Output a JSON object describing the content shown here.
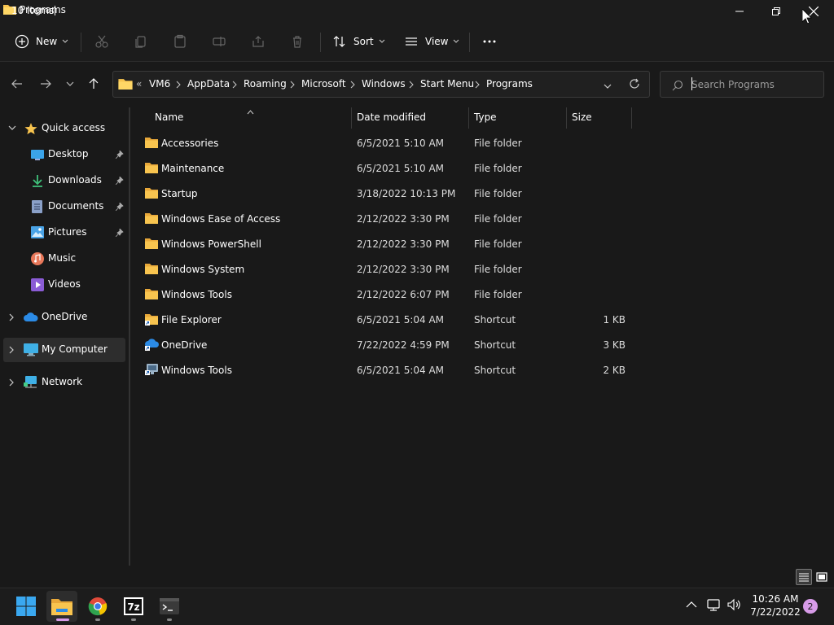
{
  "window": {
    "title": "Programs"
  },
  "toolbar": {
    "new_label": "New",
    "sort_label": "Sort",
    "view_label": "View"
  },
  "address": {
    "overflow": "«",
    "crumbs": [
      "VM6",
      "AppData",
      "Roaming",
      "Microsoft",
      "Windows",
      "Start Menu",
      "Programs"
    ]
  },
  "search": {
    "placeholder": "Search Programs"
  },
  "sidebar": {
    "quick_access": "Quick access",
    "items": [
      {
        "label": "Desktop",
        "icon": "desktop-icon",
        "pinned": true
      },
      {
        "label": "Downloads",
        "icon": "downloads-icon",
        "pinned": true
      },
      {
        "label": "Documents",
        "icon": "documents-icon",
        "pinned": true
      },
      {
        "label": "Pictures",
        "icon": "pictures-icon",
        "pinned": true
      },
      {
        "label": "Music",
        "icon": "music-icon",
        "pinned": false
      },
      {
        "label": "Videos",
        "icon": "videos-icon",
        "pinned": false
      }
    ],
    "onedrive": "OneDrive",
    "my_computer": "My Computer",
    "network": "Network"
  },
  "columns": {
    "name": "Name",
    "date": "Date modified",
    "type": "Type",
    "size": "Size"
  },
  "files": [
    {
      "name": "Accessories",
      "date": "6/5/2021 5:10 AM",
      "type": "File folder",
      "size": "",
      "icon": "folder-icon"
    },
    {
      "name": "Maintenance",
      "date": "6/5/2021 5:10 AM",
      "type": "File folder",
      "size": "",
      "icon": "folder-icon"
    },
    {
      "name": "Startup",
      "date": "3/18/2022 10:13 PM",
      "type": "File folder",
      "size": "",
      "icon": "folder-icon"
    },
    {
      "name": "Windows Ease of Access",
      "date": "2/12/2022 3:30 PM",
      "type": "File folder",
      "size": "",
      "icon": "folder-icon"
    },
    {
      "name": "Windows PowerShell",
      "date": "2/12/2022 3:30 PM",
      "type": "File folder",
      "size": "",
      "icon": "folder-icon"
    },
    {
      "name": "Windows System",
      "date": "2/12/2022 3:30 PM",
      "type": "File folder",
      "size": "",
      "icon": "folder-icon"
    },
    {
      "name": "Windows Tools",
      "date": "2/12/2022 6:07 PM",
      "type": "File folder",
      "size": "",
      "icon": "folder-icon"
    },
    {
      "name": "File Explorer",
      "date": "6/5/2021 5:04 AM",
      "type": "Shortcut",
      "size": "1 KB",
      "icon": "file-explorer-shortcut-icon"
    },
    {
      "name": "OneDrive",
      "date": "7/22/2022 4:59 PM",
      "type": "Shortcut",
      "size": "3 KB",
      "icon": "onedrive-shortcut-icon"
    },
    {
      "name": "Windows Tools",
      "date": "6/5/2021 5:04 AM",
      "type": "Shortcut",
      "size": "2 KB",
      "icon": "windows-tools-shortcut-icon"
    }
  ],
  "status": {
    "count": "10 items"
  },
  "taskbar": {
    "time": "10:26 AM",
    "date": "7/22/2022",
    "notifications": "2"
  },
  "colors": {
    "accent": "#0078d4",
    "folder": "#f8c44f",
    "background": "#191919",
    "notif_badge": "#d79be8"
  }
}
